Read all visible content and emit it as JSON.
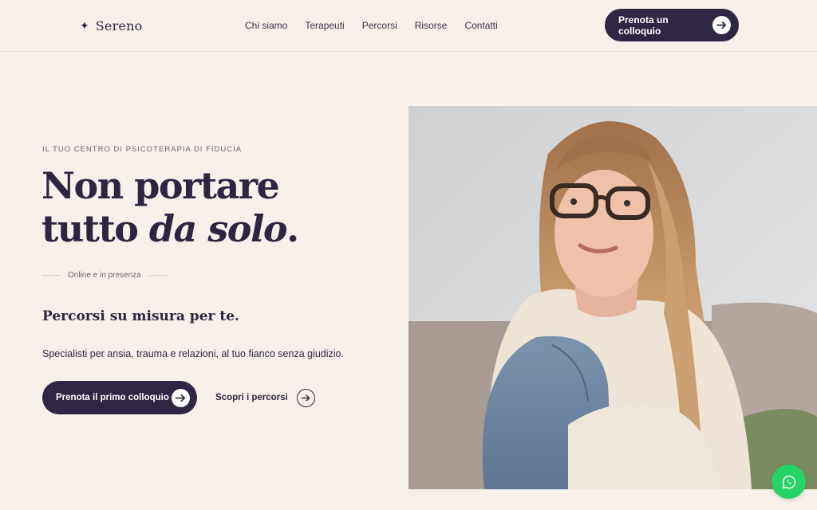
{
  "brand": {
    "name": "Sereno",
    "icon": "sparkle-icon"
  },
  "nav": {
    "items": [
      {
        "label": "Chi siamo"
      },
      {
        "label": "Terapeuti"
      },
      {
        "label": "Percorsi"
      },
      {
        "label": "Risorse"
      },
      {
        "label": "Contatti"
      }
    ],
    "cta_label": "Prenota un colloquio",
    "cta_icon": "arrow-right-icon"
  },
  "hero": {
    "eyebrow": "IL TUO CENTRO DI PSICOTERAPIA DI FIDUCIA",
    "headline_line1": "Non portare",
    "headline_line2_start": "tutto ",
    "headline_line2_italic": "da solo",
    "headline_line2_end": ".",
    "tagline": "Online e in presenza",
    "subheading": "Percorsi su misura per te.",
    "description": "Specialisti per ansia, trauma e relazioni, al tuo fianco senza giudizio.",
    "primary_cta": "Prenota il primo colloquio",
    "secondary_cta": "Scopri i percorsi",
    "photo": "portrait of a smiling young woman with glasses sitting on a couch"
  },
  "chat": {
    "icon": "whatsapp-icon"
  },
  "colors": {
    "background": "#f8f1eb",
    "primary": "#2f2641",
    "accent": "#25d366"
  }
}
